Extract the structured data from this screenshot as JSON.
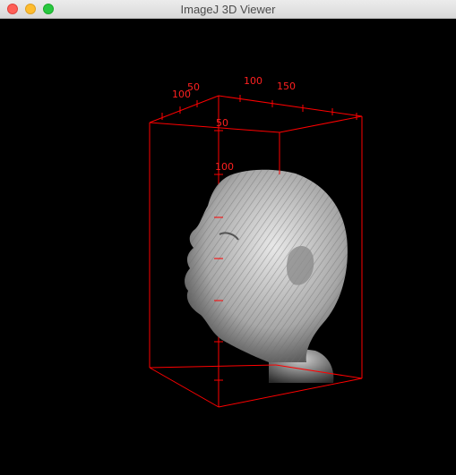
{
  "window": {
    "title": "ImageJ 3D Viewer",
    "controls": [
      "close",
      "minimize",
      "maximize"
    ]
  },
  "viewer": {
    "background": "#000000",
    "bounding_box_color": "#ff0000",
    "icon": "3d-head-volume-render",
    "axis_labels": {
      "x": [
        "50",
        "100",
        "150"
      ],
      "y": [
        "100"
      ],
      "z": [
        "50",
        "100"
      ]
    }
  }
}
